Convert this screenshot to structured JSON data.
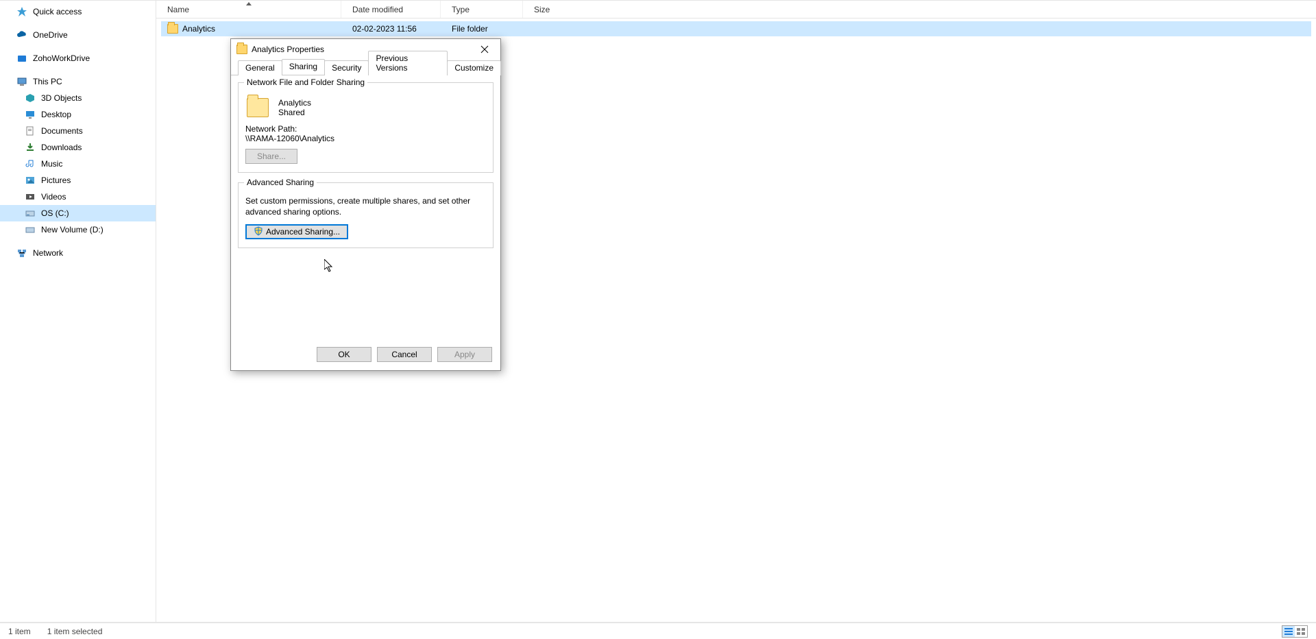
{
  "sidebar": {
    "items": [
      {
        "id": "quick-access",
        "label": "Quick access"
      },
      {
        "id": "onedrive",
        "label": "OneDrive"
      },
      {
        "id": "zoho",
        "label": "ZohoWorkDrive"
      },
      {
        "id": "thispc",
        "label": "This PC"
      },
      {
        "id": "3dobjects",
        "label": "3D Objects"
      },
      {
        "id": "desktop",
        "label": "Desktop"
      },
      {
        "id": "documents",
        "label": "Documents"
      },
      {
        "id": "downloads",
        "label": "Downloads"
      },
      {
        "id": "music",
        "label": "Music"
      },
      {
        "id": "pictures",
        "label": "Pictures"
      },
      {
        "id": "videos",
        "label": "Videos"
      },
      {
        "id": "osc",
        "label": "OS (C:)"
      },
      {
        "id": "newvol",
        "label": "New Volume (D:)"
      },
      {
        "id": "network",
        "label": "Network"
      }
    ]
  },
  "columns": {
    "name": "Name",
    "date_modified": "Date modified",
    "type": "Type",
    "size": "Size"
  },
  "file_row": {
    "name": "Analytics",
    "date_modified": "02-02-2023 11:56",
    "type": "File folder",
    "size": ""
  },
  "statusbar": {
    "count": "1 item",
    "selected": "1 item selected"
  },
  "dialog": {
    "title": "Analytics Properties",
    "tabs": {
      "general": "General",
      "sharing": "Sharing",
      "security": "Security",
      "previous": "Previous Versions",
      "customize": "Customize"
    },
    "group1": {
      "legend": "Network File and Folder Sharing",
      "folder_name": "Analytics",
      "status": "Shared",
      "netpath_label": "Network Path:",
      "netpath_value": "\\\\RAMA-12060\\Analytics",
      "share_btn": "Share..."
    },
    "group2": {
      "legend": "Advanced Sharing",
      "desc": "Set custom permissions, create multiple shares, and set other advanced sharing options.",
      "btn": "Advanced Sharing..."
    },
    "buttons": {
      "ok": "OK",
      "cancel": "Cancel",
      "apply": "Apply"
    }
  }
}
